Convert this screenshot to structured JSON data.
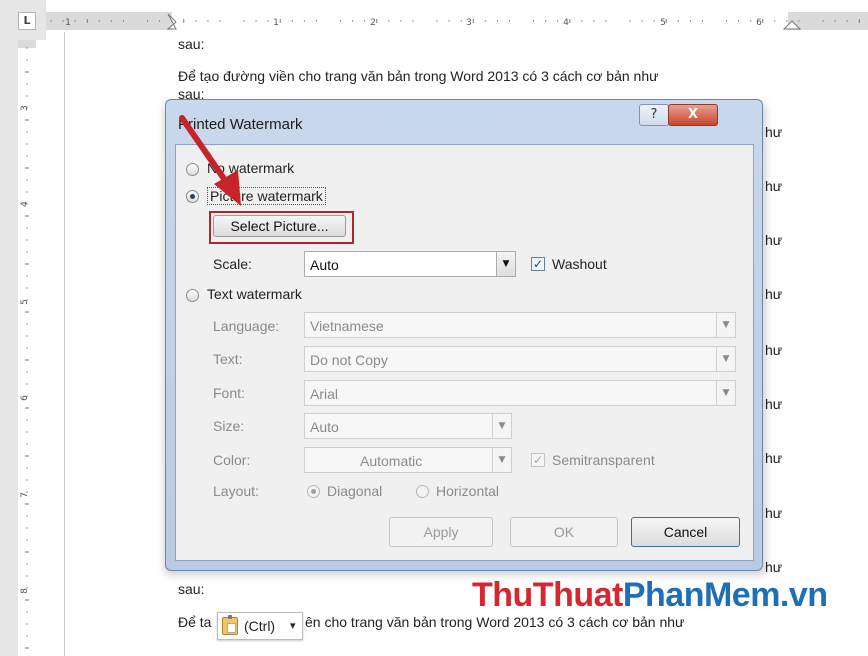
{
  "ruler": {
    "tab_selector": "L",
    "h_numbers": [
      "1",
      "1",
      "2",
      "3",
      "4",
      "5",
      "6"
    ],
    "v_numbers": [
      "3",
      "4",
      "5",
      "6",
      "7",
      "8"
    ]
  },
  "document": {
    "lines": [
      "sau:",
      "Để tạo đường viền cho trang văn bản trong Word 2013 có 3 cách cơ bản như",
      "sau:",
      "sau:",
      "Để ta",
      "ên cho trang văn bản trong Word 2013 có 3 cách cơ bản như"
    ],
    "right_fragment": "hư"
  },
  "dialog": {
    "title": "Printed Watermark",
    "help_label": "?",
    "close_label": "X",
    "no_watermark": "No watermark",
    "picture_watermark": "Picture watermark",
    "select_picture": "Select Picture...",
    "scale_label": "Scale:",
    "scale_value": "Auto",
    "washout_label": "Washout",
    "washout_checked": true,
    "text_watermark": "Text watermark",
    "language_label": "Language:",
    "language_value": "Vietnamese",
    "text_label": "Text:",
    "text_value": "Do not Copy",
    "font_label": "Font:",
    "font_value": "Arial",
    "size_label": "Size:",
    "size_value": "Auto",
    "color_label": "Color:",
    "color_value": "Automatic",
    "semitransparent_label": "Semitransparent",
    "layout_label": "Layout:",
    "diagonal_label": "Diagonal",
    "horizontal_label": "Horizontal",
    "apply_label": "Apply",
    "ok_label": "OK",
    "cancel_label": "Cancel"
  },
  "paste_options": {
    "label": "(Ctrl)",
    "dropdown": "▾"
  },
  "brand": {
    "part1": "ThuThuat",
    "part2": "PhanMem.vn"
  },
  "colors": {
    "highlight_red": "#b1252f",
    "dialog_frame": "#b9cbe3",
    "brand_red": "#d7272e",
    "brand_blue": "#1d6fb8"
  }
}
